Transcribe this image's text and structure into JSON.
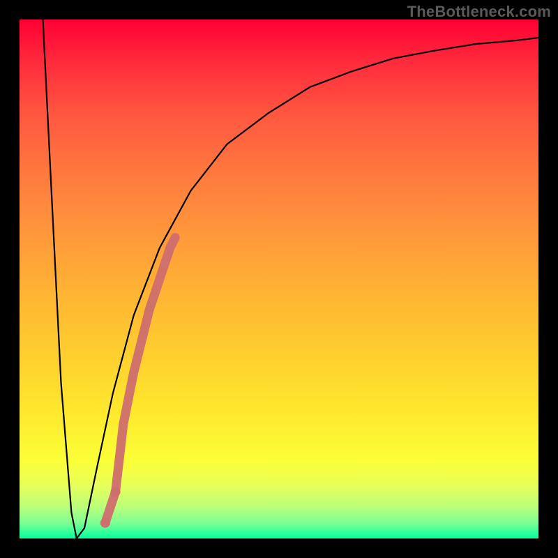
{
  "watermark": "TheBottleneck.com",
  "chart_data": {
    "type": "line",
    "title": "",
    "xlabel": "",
    "ylabel": "",
    "xlim": [
      0,
      100
    ],
    "ylim": [
      0,
      100
    ],
    "grid": false,
    "legend": false,
    "series": [
      {
        "name": "curve",
        "color": "#000000",
        "x": [
          4.5,
          6,
          8,
          10,
          11,
          12.5,
          15,
          18,
          22,
          27,
          33,
          40,
          48,
          56,
          64,
          72,
          80,
          88,
          96,
          100
        ],
        "y": [
          100,
          70,
          30,
          5,
          0,
          2,
          14,
          28,
          43,
          56,
          67,
          76,
          82,
          87,
          90,
          92.5,
          94,
          95.3,
          96,
          96.5
        ]
      }
    ],
    "markers": {
      "name": "dots",
      "color": "#cf6e6e",
      "x": [
        16.5,
        18.5,
        20,
        21,
        22,
        23,
        24,
        25,
        26,
        27,
        28,
        29,
        30
      ],
      "y": [
        3,
        9,
        22,
        27,
        32,
        36,
        40,
        44,
        47,
        50,
        53,
        56,
        58
      ]
    }
  }
}
